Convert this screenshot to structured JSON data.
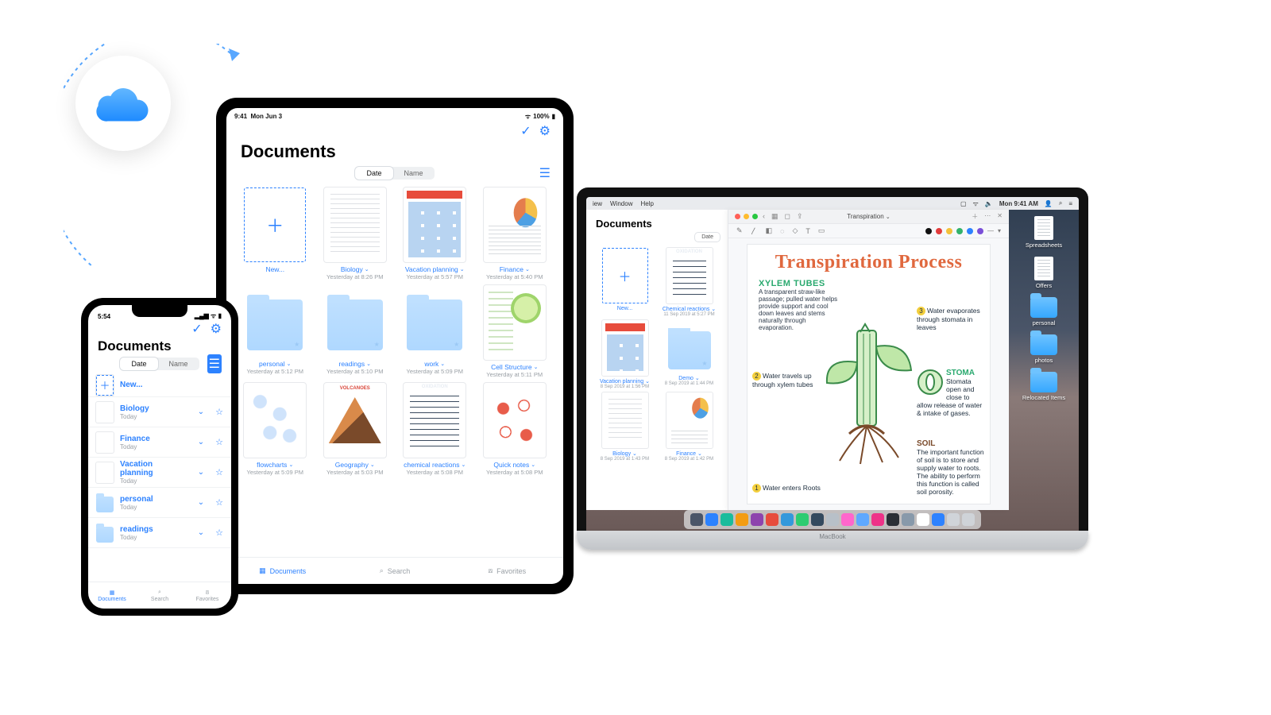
{
  "cloud": {
    "label": "iCloud"
  },
  "ipad": {
    "status": {
      "time": "9:41",
      "date": "Mon Jun 3",
      "battery": "100%"
    },
    "title": "Documents",
    "sort": {
      "options": [
        "Date",
        "Name"
      ],
      "selected": "Date"
    },
    "items": [
      {
        "kind": "new",
        "name": "New...",
        "date": ""
      },
      {
        "kind": "doc",
        "name": "Biology",
        "date": "Yesterday at 8:26 PM",
        "thumb": "lines"
      },
      {
        "kind": "doc",
        "name": "Vacation planning",
        "date": "Yesterday at 5:57 PM",
        "thumb": "photos"
      },
      {
        "kind": "doc",
        "name": "Finance",
        "date": "Yesterday at 5:40 PM",
        "thumb": "finance"
      },
      {
        "kind": "folder",
        "name": "personal",
        "date": "Yesterday at 5:12 PM"
      },
      {
        "kind": "folder",
        "name": "readings",
        "date": "Yesterday at 5:10 PM"
      },
      {
        "kind": "folder",
        "name": "work",
        "date": "Yesterday at 5:09 PM"
      },
      {
        "kind": "doc",
        "name": "Cell Structure",
        "date": "Yesterday at 5:11 PM",
        "thumb": "cell"
      },
      {
        "kind": "doc",
        "name": "flowcharts",
        "date": "Yesterday at 5:09 PM",
        "thumb": "flow"
      },
      {
        "kind": "doc",
        "name": "Geography",
        "date": "Yesterday at 5:03 PM",
        "thumb": "geo"
      },
      {
        "kind": "doc",
        "name": "chemical reactions",
        "date": "Yesterday at 5:08 PM",
        "thumb": "ox"
      },
      {
        "kind": "doc",
        "name": "Quick notes",
        "date": "Yesterday at 5:08 PM",
        "thumb": "qn"
      }
    ],
    "tabs": [
      "Documents",
      "Search",
      "Favorites"
    ],
    "active_tab": 0
  },
  "iphone": {
    "status": {
      "time": "5:54"
    },
    "title": "Documents",
    "sort": {
      "options": [
        "Date",
        "Name"
      ],
      "selected": "Date"
    },
    "items": [
      {
        "kind": "new",
        "name": "New...",
        "date": ""
      },
      {
        "kind": "doc",
        "name": "Biology",
        "date": "Today",
        "thumb": "lines"
      },
      {
        "kind": "doc",
        "name": "Finance",
        "date": "Today",
        "thumb": "finance"
      },
      {
        "kind": "doc",
        "name": "Vacation planning",
        "date": "Today",
        "thumb": "photos"
      },
      {
        "kind": "folder",
        "name": "personal",
        "date": "Today"
      },
      {
        "kind": "folder",
        "name": "readings",
        "date": "Today"
      }
    ],
    "tabs": [
      "Documents",
      "Search",
      "Favorites"
    ],
    "active_tab": 0
  },
  "mac": {
    "menubar": {
      "menus": [
        "iew",
        "Window",
        "Help"
      ],
      "clock": "Mon 9:41 AM"
    },
    "docs": {
      "title": "Documents",
      "sort_label": "Date",
      "items": [
        {
          "kind": "new",
          "name": "New...",
          "date": ""
        },
        {
          "kind": "doc",
          "name": "Chemical reactions",
          "date": "11 Sep 2019 at 5:27 PM",
          "thumb": "ox"
        },
        {
          "kind": "doc",
          "name": "Vacation planning",
          "date": "8 Sep 2019 at 1:56 PM",
          "thumb": "photos"
        },
        {
          "kind": "folder",
          "name": "Demo",
          "date": "8 Sep 2019 at 1:44 PM"
        },
        {
          "kind": "doc",
          "name": "Biology",
          "date": "8 Sep 2019 at 1:43 PM",
          "thumb": "lines"
        },
        {
          "kind": "doc",
          "name": "Finance",
          "date": "8 Sep 2019 at 1:42 PM",
          "thumb": "finance"
        }
      ]
    },
    "editor": {
      "title": "Transpiration",
      "toolbar_colors": [
        "#111111",
        "#e23b3b",
        "#f3c13a",
        "#33b26b",
        "#2d82ff",
        "#7a4fd8"
      ],
      "note": {
        "heading": "Transpiration Process",
        "subheading": "XYLEM TUBES",
        "sub_body": "A transparent straw-like passage; pulled water helps provide support and cool down leaves and stems naturally through evaporation.",
        "callouts": [
          {
            "n": "1",
            "text": "Water enters Roots"
          },
          {
            "n": "2",
            "text": "Water travels up through xylem tubes"
          },
          {
            "n": "3",
            "text": "Water evaporates through stomata in leaves"
          }
        ],
        "stoma": {
          "title": "STOMA",
          "text": "Stomata open and close to allow release of water & intake of gases."
        },
        "soil": {
          "title": "SOIL",
          "text": "The important function of soil is to store and supply water to roots. The ability to perform this function is called soil porosity."
        }
      }
    },
    "desktop": [
      {
        "type": "doc",
        "name": "Spreadsheets"
      },
      {
        "type": "doc",
        "name": "Offers"
      },
      {
        "type": "folder",
        "name": "personal"
      },
      {
        "type": "folder",
        "name": "photos"
      },
      {
        "type": "folder",
        "name": "Relocated Items"
      }
    ],
    "dock_colors": [
      "#4a5568",
      "#2d82ff",
      "#1abc9c",
      "#f39c12",
      "#8e44ad",
      "#e74c3c",
      "#3498db",
      "#2ecc71",
      "#34495e",
      "#b8c0c8",
      "#ff66cc",
      "#5fa8ff",
      "#ee3388",
      "#2b2f36",
      "#8899aa",
      "#ffffff",
      "#2d82ff",
      "#d0d4d9",
      "#cfd3d8"
    ]
  }
}
